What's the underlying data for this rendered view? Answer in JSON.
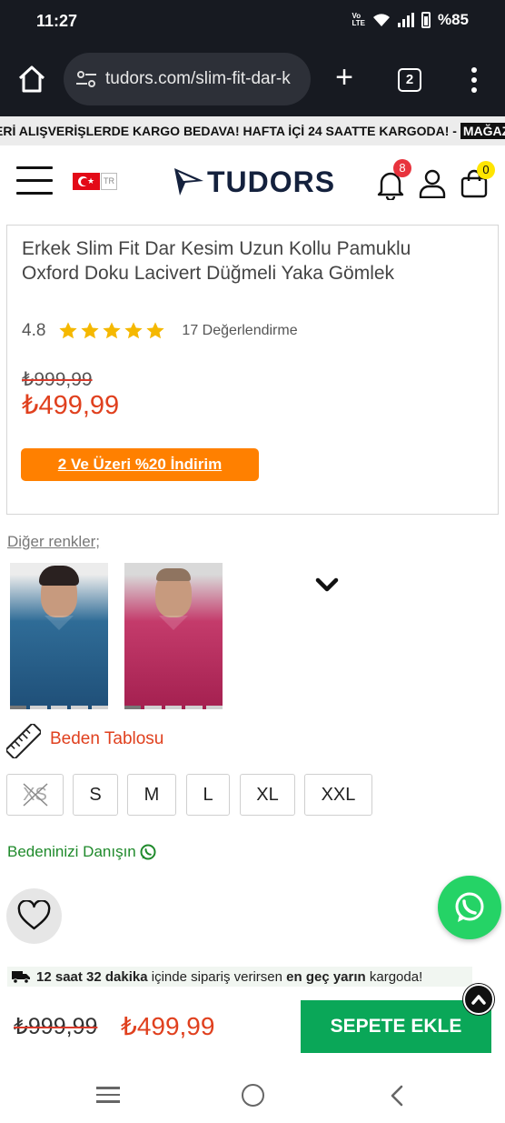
{
  "status_bar": {
    "time": "11:27",
    "volte": "VoLTE",
    "battery": "%85"
  },
  "browser": {
    "url": "tudors.com/slim-fit-dar-k",
    "tab_count": "2"
  },
  "announcement": {
    "text": "ERİ ALIŞVERİŞLERDE KARGO BEDAVA! HAFTA İÇİ 24 SAATTE KARGODA! - ",
    "highlight": "MAĞAZ"
  },
  "header": {
    "language": "TR",
    "brand": "TUDORS",
    "notification_count": "8",
    "cart_count": "0"
  },
  "product": {
    "title": "Erkek Slim Fit Dar Kesim Uzun Kollu Pamuklu Oxford Doku Lacivert Düğmeli Yaka Gömlek",
    "rating": "4.8",
    "stars": 5,
    "review_count": "17 Değerlendirme",
    "old_price": "₺999,99",
    "price": "₺499,99",
    "promo": "2 Ve Üzeri %20 İndirim"
  },
  "other_colors_label": "Diğer renkler;",
  "size_guide_label": "Beden Tablosu",
  "sizes": [
    {
      "label": "XS",
      "available": false
    },
    {
      "label": "S",
      "available": true
    },
    {
      "label": "M",
      "available": true
    },
    {
      "label": "L",
      "available": true
    },
    {
      "label": "XL",
      "available": true
    },
    {
      "label": "XXL",
      "available": true
    }
  ],
  "consult_label": "Bedeninizi Danışın",
  "shipping": {
    "bold1": "12 saat 32 dakika",
    "mid": " içinde sipariş verirsen ",
    "bold2": "en geç yarın",
    "end": " kargoda!"
  },
  "bottom_bar": {
    "old_price": "₺999,99",
    "price": "₺499,99",
    "cart_button": "SEPETE EKLE"
  },
  "colors": {
    "accent_orange": "#ff8000",
    "price_red": "#e0401e",
    "cart_green": "#0aa758",
    "whatsapp": "#25d366",
    "star": "#f5b800"
  }
}
